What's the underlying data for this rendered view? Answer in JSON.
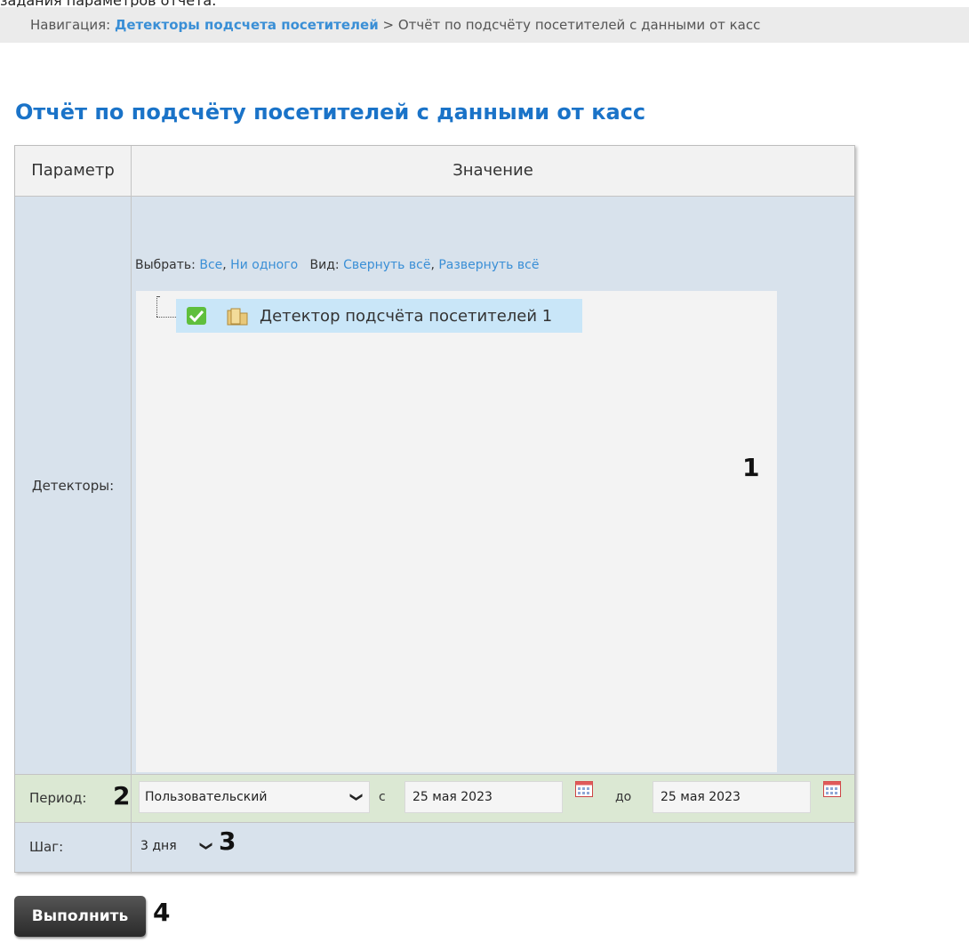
{
  "cut_text": "задания параметров отчета.",
  "breadcrumb": {
    "prefix": "Навигация:",
    "link": "Детекторы подсчета посетителей",
    "separator": ">",
    "current": "Отчёт по подсчёту посетителей с данными от касс"
  },
  "page_title": "Отчёт по подсчёту посетителей с данными от касс",
  "table": {
    "header_param": "Параметр",
    "header_value": "Значение"
  },
  "detectors": {
    "label": "Детекторы:",
    "select_prefix": "Выбрать:",
    "select_all": "Все",
    "select_none": "Ни одного",
    "view_prefix": "Вид:",
    "collapse_all": "Свернуть всё",
    "expand_all": "Развернуть всё",
    "tree_items": [
      {
        "label": "Детектор подсчёта посетителей 1",
        "checked": true
      }
    ]
  },
  "period": {
    "label": "Период:",
    "selected": "Пользовательский",
    "from_label": "с",
    "from_date": "25 мая 2023",
    "to_label": "до",
    "to_date": "25 мая 2023"
  },
  "step": {
    "label": "Шаг:",
    "selected": "3 дня"
  },
  "markers": [
    "1",
    "2",
    "3",
    "4"
  ],
  "run_button": "Выполнить",
  "colors": {
    "link": "#3a8fd6",
    "title": "#1a73c8",
    "row_blue": "#d8e2ec",
    "row_green": "#dbe8d3",
    "selected_node": "#c9e6f8"
  }
}
